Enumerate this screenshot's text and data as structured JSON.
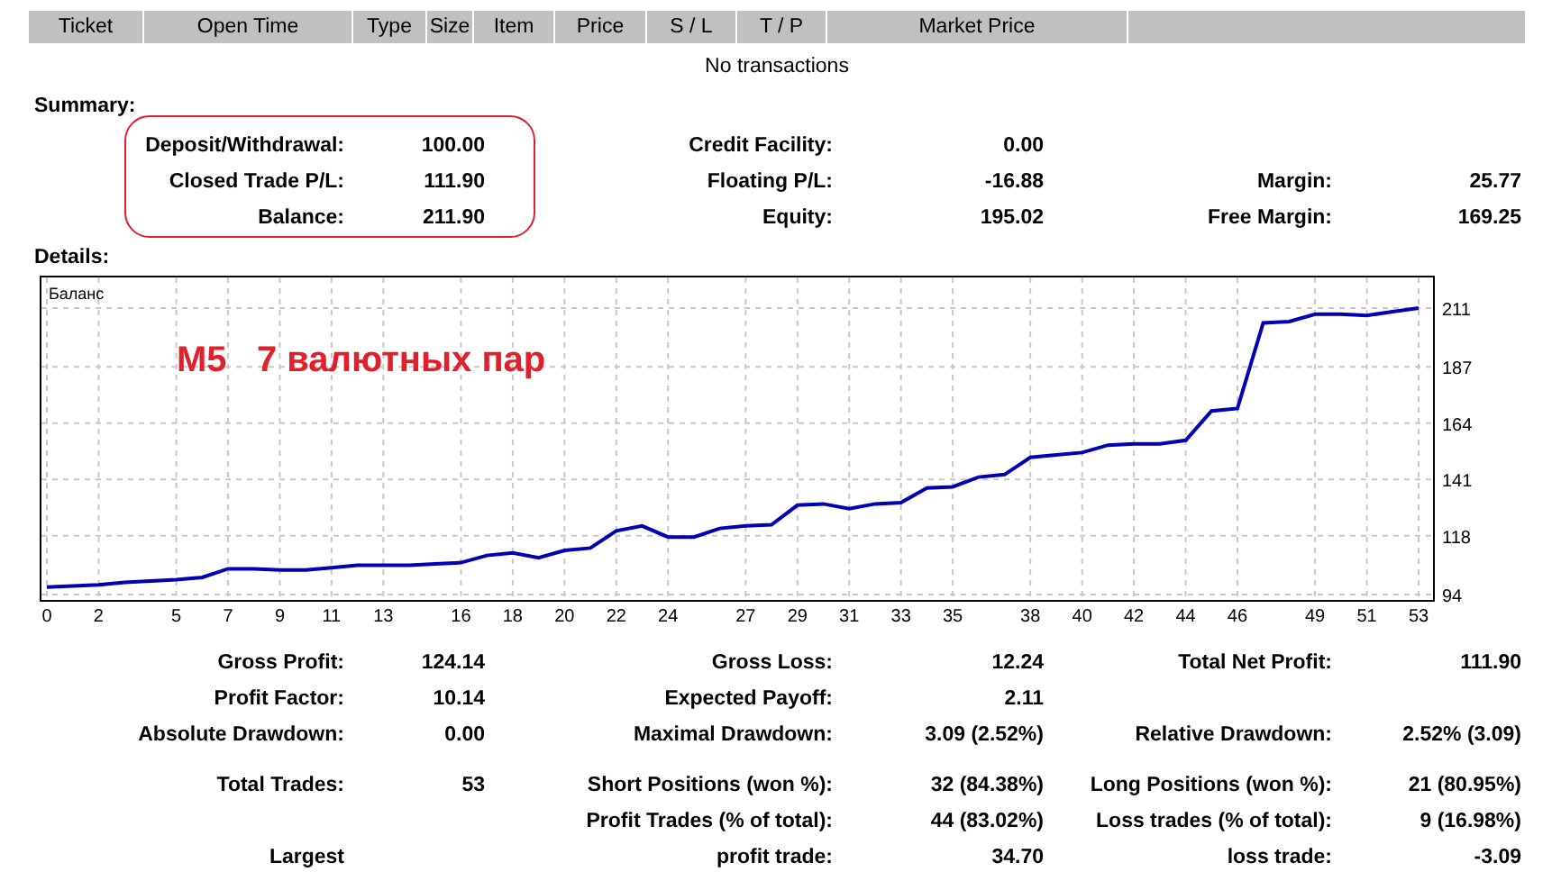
{
  "orders_table": {
    "columns": [
      "Ticket",
      "Open Time",
      "Type",
      "Size",
      "Item",
      "Price",
      "S / L",
      "T / P",
      "Market Price"
    ],
    "empty_message": "No transactions"
  },
  "summary": {
    "title": "Summary:",
    "rows": [
      {
        "left": {
          "label": "Deposit/Withdrawal:",
          "value": "100.00"
        },
        "middle": {
          "label": "Credit Facility:",
          "value": "0.00"
        }
      },
      {
        "left": {
          "label": "Closed Trade P/L:",
          "value": "111.90"
        },
        "middle": {
          "label": "Floating P/L:",
          "value": "-16.88"
        },
        "right": {
          "label": "Margin:",
          "value": "25.77"
        }
      },
      {
        "left": {
          "label": "Balance:",
          "value": "211.90"
        },
        "middle": {
          "label": "Equity:",
          "value": "195.02"
        },
        "right": {
          "label": "Free Margin:",
          "value": "169.25"
        }
      }
    ]
  },
  "details": {
    "title": "Details:",
    "caption": "M5   7 валютных пар",
    "chart_data": {
      "type": "line",
      "title": "Баланс",
      "x": [
        0,
        1,
        2,
        3,
        4,
        5,
        6,
        7,
        8,
        9,
        10,
        11,
        12,
        13,
        14,
        15,
        16,
        17,
        18,
        19,
        20,
        21,
        22,
        23,
        24,
        25,
        26,
        27,
        28,
        29,
        30,
        31,
        32,
        33,
        34,
        35,
        36,
        37,
        38,
        39,
        40,
        41,
        42,
        43,
        44,
        45,
        46,
        47,
        48,
        49,
        50,
        51,
        52,
        53
      ],
      "series": [
        {
          "color": "#0000b4",
          "values": [
            97,
            97.5,
            98,
            99,
            99.5,
            100,
            101,
            104.5,
            104.5,
            104,
            104,
            105,
            106,
            106,
            106,
            106.5,
            107,
            110,
            111,
            109,
            112,
            113,
            120,
            122,
            117.5,
            117.5,
            121,
            122,
            122.5,
            130.5,
            131,
            129,
            131,
            131.5,
            137.5,
            138,
            142,
            143,
            150,
            151,
            152,
            155,
            155.5,
            155.5,
            157,
            169,
            170,
            205,
            205.5,
            208.5,
            208.5,
            208,
            209.5,
            211
          ]
        }
      ],
      "grid": true,
      "xlim": [
        0,
        53
      ],
      "ylim": [
        94,
        211
      ],
      "xticks": [
        0,
        2,
        5,
        7,
        9,
        11,
        13,
        16,
        18,
        20,
        22,
        24,
        27,
        29,
        31,
        33,
        35,
        38,
        40,
        42,
        44,
        46,
        49,
        51,
        53
      ],
      "yticks": [
        94,
        118,
        141,
        164,
        187,
        211
      ]
    }
  },
  "stats": {
    "groups": [
      [
        {
          "left": {
            "label": "Gross Profit:",
            "value": "124.14"
          },
          "middle": {
            "label": "Gross Loss:",
            "value": "12.24"
          },
          "right": {
            "label": "Total Net Profit:",
            "value": "111.90"
          }
        },
        {
          "left": {
            "label": "Profit Factor:",
            "value": "10.14"
          },
          "middle": {
            "label": "Expected Payoff:",
            "value": "2.11"
          }
        },
        {
          "left": {
            "label": "Absolute Drawdown:",
            "value": "0.00"
          },
          "middle": {
            "label": "Maximal Drawdown:",
            "value": "3.09 (2.52%)"
          },
          "right": {
            "label": "Relative Drawdown:",
            "value": "2.52% (3.09)"
          }
        }
      ],
      [
        {
          "left": {
            "label": "Total Trades:",
            "value": "53"
          },
          "middle": {
            "label": "Short Positions (won %):",
            "value": "32 (84.38%)"
          },
          "right": {
            "label": "Long Positions (won %):",
            "value": "21 (80.95%)"
          }
        },
        {
          "middle": {
            "label": "Profit Trades (% of total):",
            "value": "44 (83.02%)"
          },
          "right": {
            "label": "Loss trades (% of total):",
            "value": "9 (16.98%)"
          }
        },
        {
          "left": {
            "label": "Largest"
          },
          "middle": {
            "label": "profit trade:",
            "value": "34.70"
          },
          "right": {
            "label": "loss trade:",
            "value": "-3.09"
          }
        }
      ]
    ]
  }
}
